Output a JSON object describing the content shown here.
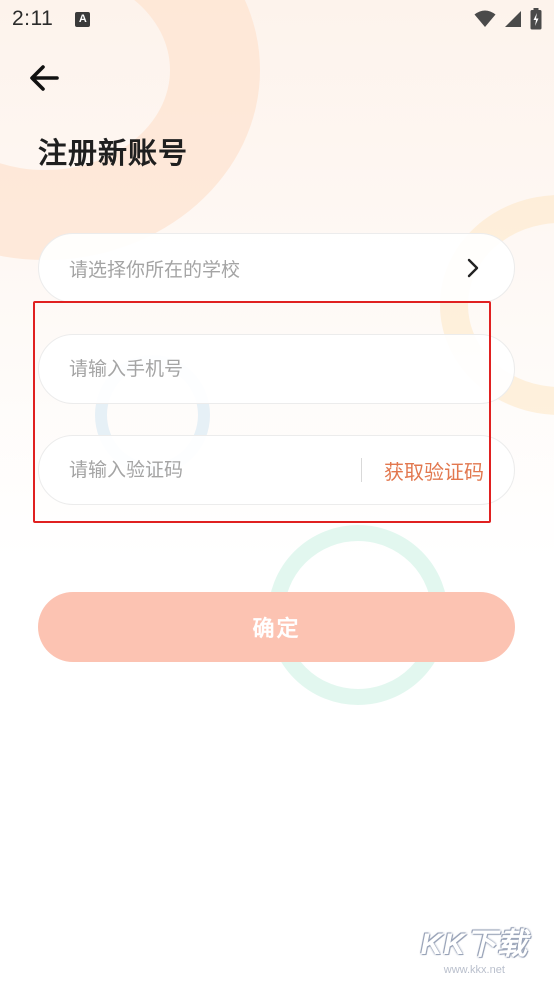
{
  "status_bar": {
    "time": "2:11",
    "notification_icon": "A"
  },
  "header": {
    "back_icon": "arrow-left-icon",
    "title": "注册新账号"
  },
  "form": {
    "school": {
      "placeholder": "请选择你所在的学校",
      "icon": "chevron-right-icon"
    },
    "phone": {
      "placeholder": "请输入手机号",
      "value": ""
    },
    "code": {
      "placeholder": "请输入验证码",
      "value": "",
      "get_code_label": "获取验证码"
    },
    "confirm_label": "确定"
  },
  "watermark": {
    "logo_text": "KK下载",
    "url": "www.kkx.net"
  },
  "colors": {
    "accent": "#e2784f",
    "confirm_button": "#fcc3b2",
    "highlight_border": "#e02020"
  }
}
